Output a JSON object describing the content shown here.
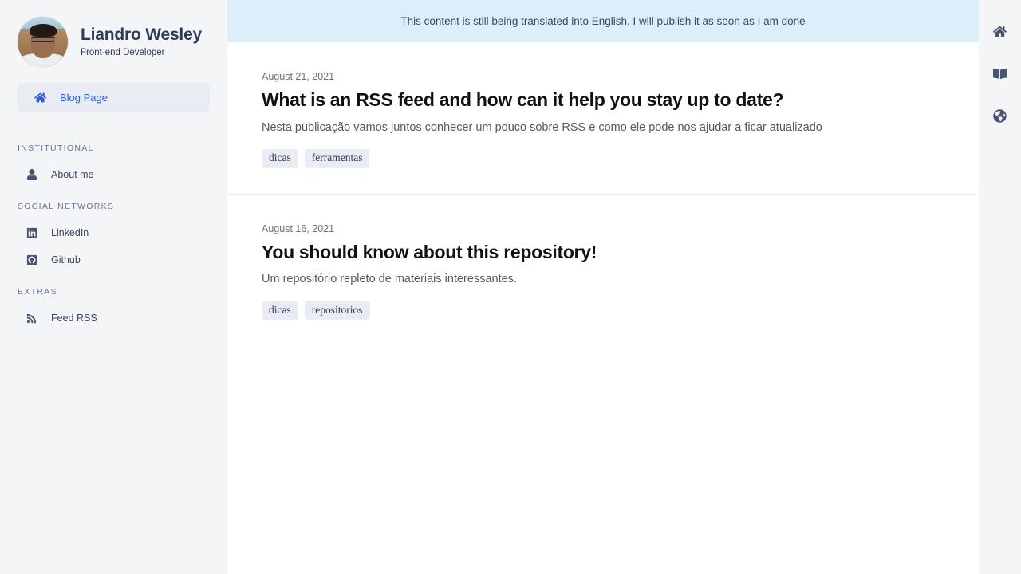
{
  "profile": {
    "name": "Liandro Wesley",
    "role": "Front-end Developer",
    "avatar_icon": "user-avatar-photo"
  },
  "sidebar": {
    "active_item": {
      "label": "Blog Page",
      "icon": "home-icon"
    },
    "groups": [
      {
        "title": "INSTITUTIONAL",
        "items": [
          {
            "label": "About me",
            "icon": "person-icon"
          }
        ]
      },
      {
        "title": "SOCIAL NETWORKS",
        "items": [
          {
            "label": "LinkedIn",
            "icon": "linkedin-icon"
          },
          {
            "label": "Github",
            "icon": "github-icon"
          }
        ]
      },
      {
        "title": "EXTRAS",
        "items": [
          {
            "label": "Feed RSS",
            "icon": "rss-icon"
          }
        ]
      }
    ]
  },
  "notice": {
    "text": "This content is still being translated into English. I will publish it as soon as I am done",
    "background": "#ddeefb"
  },
  "posts": [
    {
      "date": "August 21, 2021",
      "title": "What is an RSS feed and how can it help you stay up to date?",
      "excerpt": "Nesta publicação vamos juntos conhecer um pouco sobre RSS e como ele pode nos ajudar a ficar atualizado",
      "tags": [
        "dicas",
        "ferramentas"
      ]
    },
    {
      "date": "August 16, 2021",
      "title": "You should know about this repository!",
      "excerpt": "Um repositório repleto de materiais interessantes.",
      "tags": [
        "dicas",
        "repositorios"
      ]
    }
  ],
  "right_rail": {
    "buttons": [
      {
        "icon": "home-icon",
        "name": "home"
      },
      {
        "icon": "book-open-icon",
        "name": "read"
      },
      {
        "icon": "globe-icon",
        "name": "language"
      }
    ]
  },
  "colors": {
    "accent": "#2b5fd9",
    "page_background": "#f4f5f7",
    "content_background": "#ffffff",
    "notice_background": "#ddeefb",
    "text_dark": "#2e3a59",
    "tag_background": "#e9edf3"
  }
}
